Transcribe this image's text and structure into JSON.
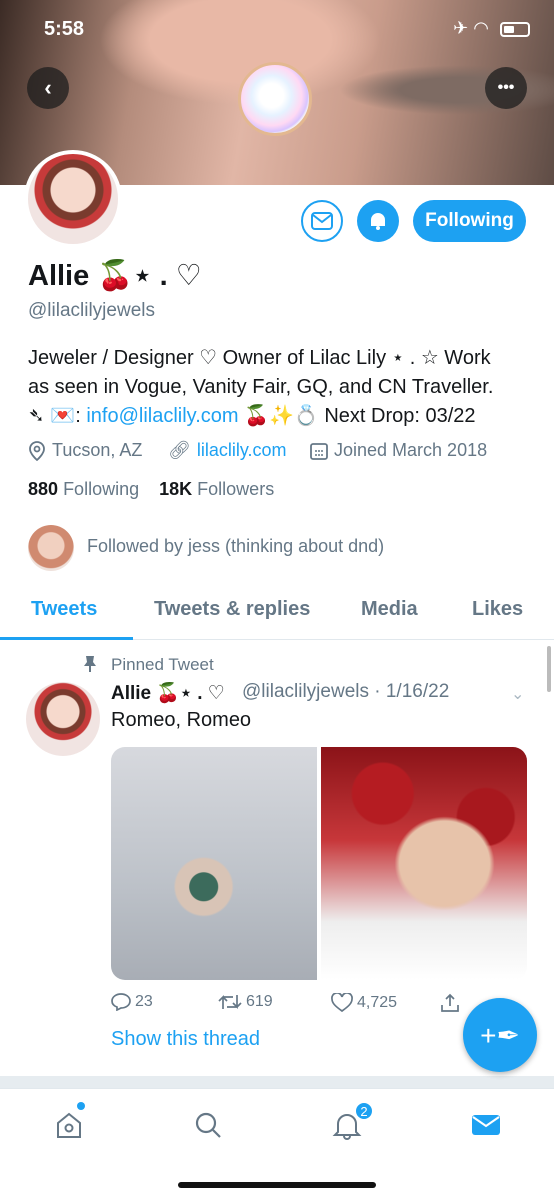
{
  "status_bar": {
    "time": "5:58"
  },
  "profile": {
    "name": "Allie 🍒⋆ . ♡",
    "handle": "@lilaclilyjewels",
    "following_label": "Following",
    "bio_line1": "Jeweler / Designer ♡ Owner of Lilac Lily ⋆ . ☆ Work",
    "bio_line2": "as seen in Vogue, Vanity Fair, GQ, and CN Traveller.",
    "bio_line3_prefix": "➴ 💌: ",
    "bio_email": "info@lilaclily.com",
    "bio_line3_suffix": " 🍒✨💍 Next Drop: 03/22",
    "location": "Tucson, AZ",
    "website": "lilaclily.com",
    "joined": "Joined March 2018",
    "following_count": "880",
    "following_text": "Following",
    "followers_count": "18K",
    "followers_text": "Followers",
    "followed_by": "Followed by jess (thinking about dnd)"
  },
  "tabs": [
    "Tweets",
    "Tweets & replies",
    "Media",
    "Likes"
  ],
  "tweet": {
    "pinned_label": "Pinned Tweet",
    "name": "Allie 🍒⋆ . ♡",
    "handle_date": "@lilaclilyjewels · 1/16/22",
    "text": "Romeo, Romeo",
    "replies": "23",
    "retweets": "619",
    "likes": "4,725",
    "show_thread": "Show this thread"
  },
  "nav": {
    "notifications_badge": "2"
  },
  "colors": {
    "accent": "#1da1f2",
    "secondary_text": "#657786"
  }
}
